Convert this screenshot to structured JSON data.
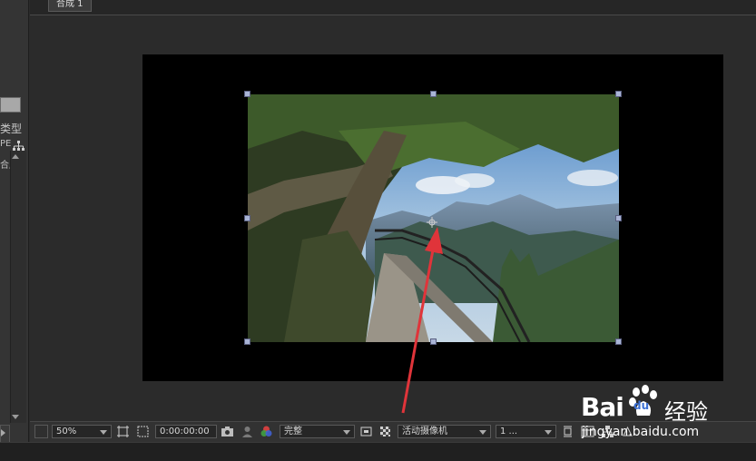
{
  "composition_tab": {
    "label": "合成 1"
  },
  "left_panel": {
    "column_header": "类型",
    "row1": "PE",
    "row2": "合成"
  },
  "toolbar": {
    "zoom": "50%",
    "timecode": "0:00:00:00",
    "resolution": "完整",
    "camera": "活动摄像机",
    "views": "1 ..."
  },
  "watermark": {
    "brand": "Bai",
    "brand_suffix": "du",
    "product": "经验",
    "url": "jingyan.baidu.com"
  },
  "colors": {
    "accent_arrow": "#e0343a",
    "handle": "#a9b4d6",
    "canvas": "#000000",
    "panel_bg": "#2b2b2b"
  }
}
